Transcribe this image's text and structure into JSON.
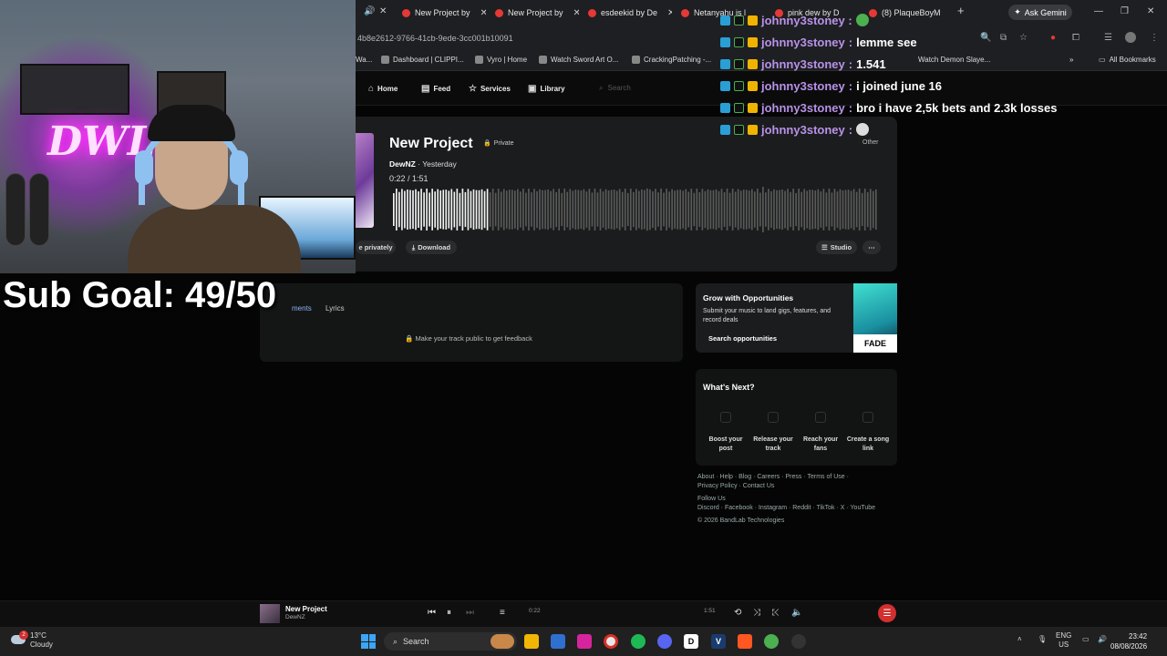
{
  "browser": {
    "tabs": [
      "New Project by",
      "New Project by",
      "esdeekid by De",
      "Netanyahu is l",
      "pink dew by D",
      "(8) PlaqueBoyM"
    ],
    "ask_gemini": "Ask Gemini",
    "url": "4b8e2612-9766-41cb-9ede-3cc001b10091",
    "bookmarks": [
      "Wa...",
      "Dashboard | CLIPPI...",
      "Vyro | Home",
      "Watch Sword Art O...",
      "CrackingPatching -...",
      "Watch Demon Slaye..."
    ],
    "all_bookmarks": "All Bookmarks"
  },
  "nav": {
    "home": "Home",
    "feed": "Feed",
    "services": "Services",
    "library": "Library",
    "search_placeholder": "Search"
  },
  "track": {
    "title": "New Project",
    "visibility": "Private",
    "artist": "DewNZ",
    "posted": "Yesterday",
    "time_current": "0:22",
    "time_total": "1:51",
    "progress": 0.198,
    "other_label": "Other",
    "share_label": "e privately",
    "download_label": "Download",
    "studio_label": "Studio"
  },
  "comments": {
    "tab_comments": "ments",
    "tab_lyrics": "Lyrics",
    "feedback_text": "Make your track public to get feedback"
  },
  "promo": {
    "title": "Grow with Opportunities",
    "subtitle": "Submit your music to land gigs, features, and record deals",
    "link": "Search opportunities",
    "brand": "FADE"
  },
  "next": {
    "title": "What's Next?",
    "items": [
      "Boost your post",
      "Release your track",
      "Reach your fans",
      "Create a song link"
    ]
  },
  "footer": {
    "links1": "About · Help · Blog · Careers · Press · Terms of Use ·",
    "links2": "Privacy Policy · Contact Us",
    "follow": "Follow Us",
    "social": "Discord · Facebook · Instagram · Reddit · TikTok · X · YouTube",
    "copyright": "© 2026 BandLab Technologies"
  },
  "player": {
    "title": "New Project",
    "artist": "DewNZ",
    "time_current": "0:22",
    "time_total": "1:51"
  },
  "stream": {
    "sub_goal": "Sub Goal: 49/50",
    "chat": [
      {
        "user": "johnny3stoney",
        "message": "lemme see"
      },
      {
        "user": "johnny3stoney",
        "message": "1.541"
      },
      {
        "user": "johnny3stoney",
        "message": "i joined june 16"
      },
      {
        "user": "johnny3stoney",
        "message": "bro i have 2,5k bets and 2.3k losses"
      },
      {
        "user": "johnny3stoney",
        "message": ""
      }
    ],
    "chat_top_user": "johnny3stoney :",
    "chat_first_user": "johnny3stoney :"
  },
  "taskbar": {
    "temp": "13°C",
    "condition": "Cloudy",
    "weather_badge": "2",
    "search": "Search",
    "lang": "ENG",
    "region": "US",
    "time": "23:42",
    "date": "08/08/2026"
  },
  "colors": {
    "accent": "#d32f2f",
    "chat_user": "#b892e8",
    "link": "#8ab4f8"
  }
}
